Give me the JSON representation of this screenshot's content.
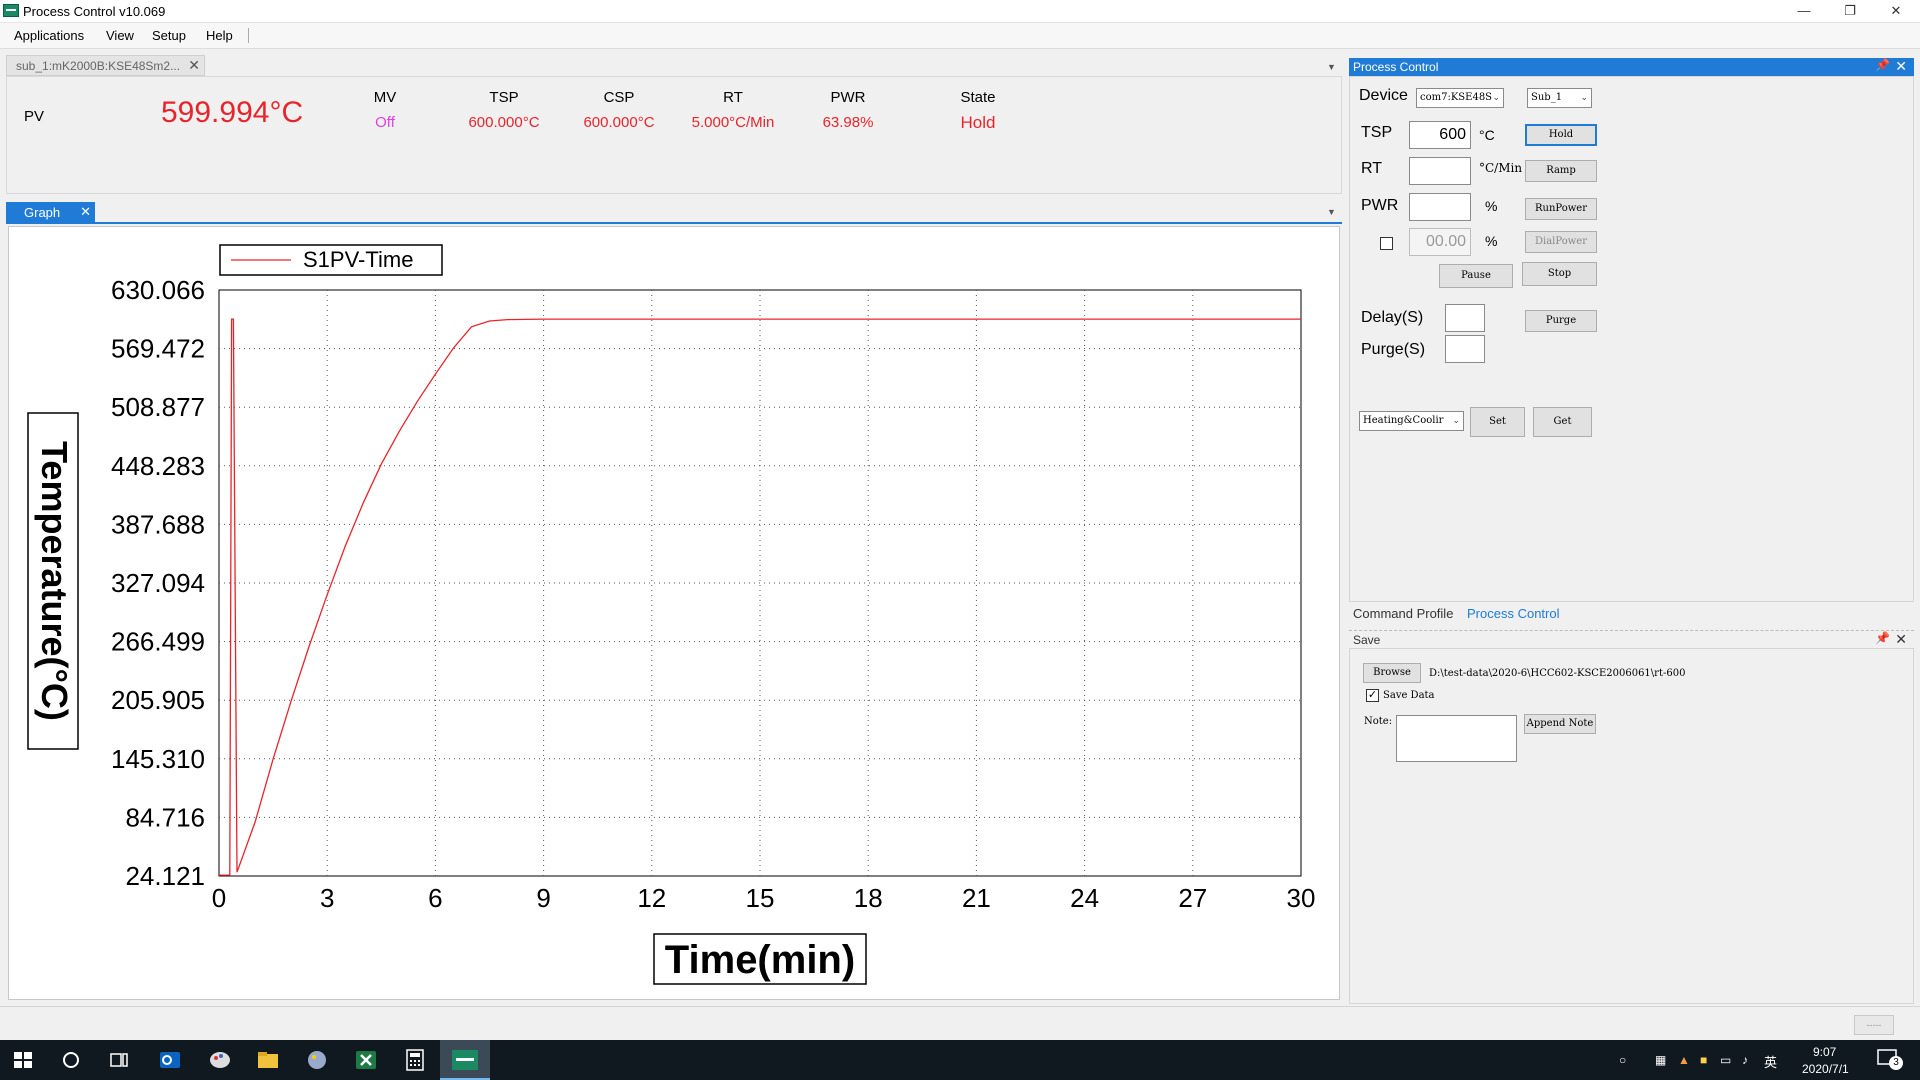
{
  "window": {
    "title": "Process Control v10.069"
  },
  "menu": [
    "Applications",
    "View",
    "Setup",
    "Help"
  ],
  "doc_tab": {
    "label": "sub_1:mK2000B:KSE48Sm2..."
  },
  "readout": {
    "pv_label": "PV",
    "pv_value": "599.994°C",
    "columns": [
      {
        "label": "MV",
        "value": "Off",
        "color": "#e040e0"
      },
      {
        "label": "TSP",
        "value": "600.000°C",
        "color": "#e8242b"
      },
      {
        "label": "CSP",
        "value": "600.000°C",
        "color": "#e8242b"
      },
      {
        "label": "RT",
        "value": "5.000°C/Min",
        "color": "#e8242b"
      },
      {
        "label": "PWR",
        "value": "63.98%",
        "color": "#e8242b"
      },
      {
        "label": "State",
        "value": "Hold",
        "color": "#e8242b"
      }
    ]
  },
  "graph_tab": {
    "label": "Graph"
  },
  "chart_data": {
    "type": "line",
    "title": "",
    "legend": "S1PV-Time",
    "legend_position": "top-left",
    "xlabel": "Time(min)",
    "ylabel": "Temperature(°C)",
    "xlim": [
      0,
      30
    ],
    "ylim": [
      24.121,
      630.066
    ],
    "x_ticks": [
      "0",
      "3",
      "6",
      "9",
      "12",
      "15",
      "18",
      "21",
      "24",
      "27",
      "30"
    ],
    "y_ticks": [
      "630.066",
      "569.472",
      "508.877",
      "448.283",
      "387.688",
      "327.094",
      "266.499",
      "205.905",
      "145.310",
      "84.716",
      "24.121"
    ],
    "grid": true,
    "series": [
      {
        "name": "S1PV-Time",
        "color": "#e8242b",
        "x": [
          0,
          0.3,
          0.35,
          0.4,
          0.5,
          1,
          1.5,
          2,
          2.5,
          3,
          3.5,
          4,
          4.5,
          5,
          5.5,
          6,
          6.5,
          7,
          7.5,
          8,
          9,
          10,
          12,
          15,
          18,
          21,
          24,
          27,
          30
        ],
        "y": [
          25,
          25,
          600,
          600,
          28,
          80,
          145,
          205,
          262,
          315,
          365,
          410,
          450,
          484,
          515,
          543,
          570,
          592,
          598,
          599.5,
          600,
          600,
          600,
          600,
          600,
          600,
          600,
          600,
          600
        ]
      }
    ]
  },
  "process_control": {
    "header": "Process Control",
    "device_label": "Device",
    "device_value": "com7:KSE48S",
    "sub_value": "Sub_1",
    "tsp_label": "TSP",
    "tsp_value": "600",
    "tsp_unit": "°C",
    "rt_label": "RT",
    "rt_value": "",
    "rt_unit": "°C/Min",
    "pwr_label": "PWR",
    "pwr_value": "",
    "pwr_unit": "%",
    "dial_value": "00.00",
    "dial_unit": "%",
    "buttons": {
      "hold": "Hold",
      "ramp": "Ramp",
      "runpower": "RunPower",
      "dialpower": "DialPower",
      "pause": "Pause",
      "stop": "Stop",
      "purge": "Purge",
      "set": "Set",
      "get": "Get"
    },
    "delay_label": "Delay(S)",
    "delay_value": "",
    "purge_label": "Purge(S)",
    "purge_value": "",
    "mode_value": "Heating&Coolir"
  },
  "bottom_tabs": [
    "Command Profile",
    "Process Control"
  ],
  "save": {
    "header": "Save",
    "browse": "Browse",
    "path": "D:\\test-data\\2020-6\\HCC602-KSCE2006061\\rt-600",
    "save_data_label": "Save Data",
    "save_data_checked": true,
    "note_label": "Note:",
    "append_note": "Append Note"
  },
  "status": {
    "box": "-----"
  },
  "taskbar": {
    "time": "9:07",
    "date": "2020/7/1",
    "ime": "英",
    "notifications": "3"
  }
}
